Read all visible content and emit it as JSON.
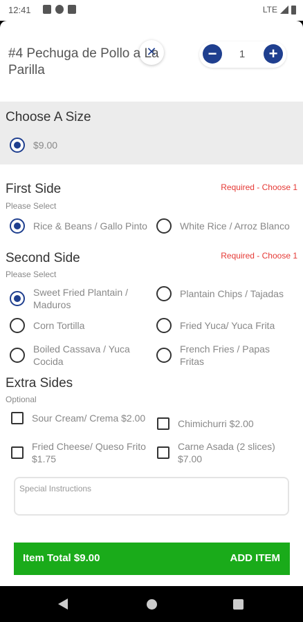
{
  "status_bar": {
    "time": "12:41",
    "network": "LTE"
  },
  "item": {
    "title": "#4 Pechuga de Pollo a La Parilla",
    "quantity": "1"
  },
  "size": {
    "title": "Choose A Size",
    "options": [
      {
        "label": "$9.00",
        "selected": true
      }
    ]
  },
  "first_side": {
    "title": "First Side",
    "subtitle": "Please Select",
    "requirement": "Required - Choose 1",
    "options": [
      {
        "label": "Rice & Beans / Gallo Pinto",
        "selected": true
      },
      {
        "label": "White Rice / Arroz Blanco",
        "selected": false
      }
    ]
  },
  "second_side": {
    "title": "Second Side",
    "subtitle": "Please Select",
    "requirement": "Required - Choose 1",
    "options": [
      {
        "label": "Sweet Fried Plantain / Maduros",
        "selected": true
      },
      {
        "label": "Plantain Chips / Tajadas",
        "selected": false
      },
      {
        "label": "Corn Tortilla",
        "selected": false
      },
      {
        "label": "Fried Yuca/ Yuca Frita",
        "selected": false
      },
      {
        "label": "Boiled Cassava / Yuca Cocida",
        "selected": false
      },
      {
        "label": "French Fries / Papas Fritas",
        "selected": false
      }
    ]
  },
  "extra_sides": {
    "title": "Extra Sides",
    "subtitle": "Optional",
    "options": [
      {
        "label": "Sour Cream/ Crema $2.00",
        "checked": false
      },
      {
        "label": "Chimichurri  $2.00",
        "checked": false
      },
      {
        "label": "Fried Cheese/ Queso Frito $1.75",
        "checked": false
      },
      {
        "label": "Carne Asada (2 slices) $7.00",
        "checked": false
      }
    ]
  },
  "special_instructions": {
    "placeholder": "Special Instructions"
  },
  "footer": {
    "total_label": "Item Total $9.00",
    "add_label": "ADD ITEM"
  },
  "colors": {
    "accent": "#1f3f8f",
    "add_button": "#1aab1a",
    "required": "#e53935"
  }
}
